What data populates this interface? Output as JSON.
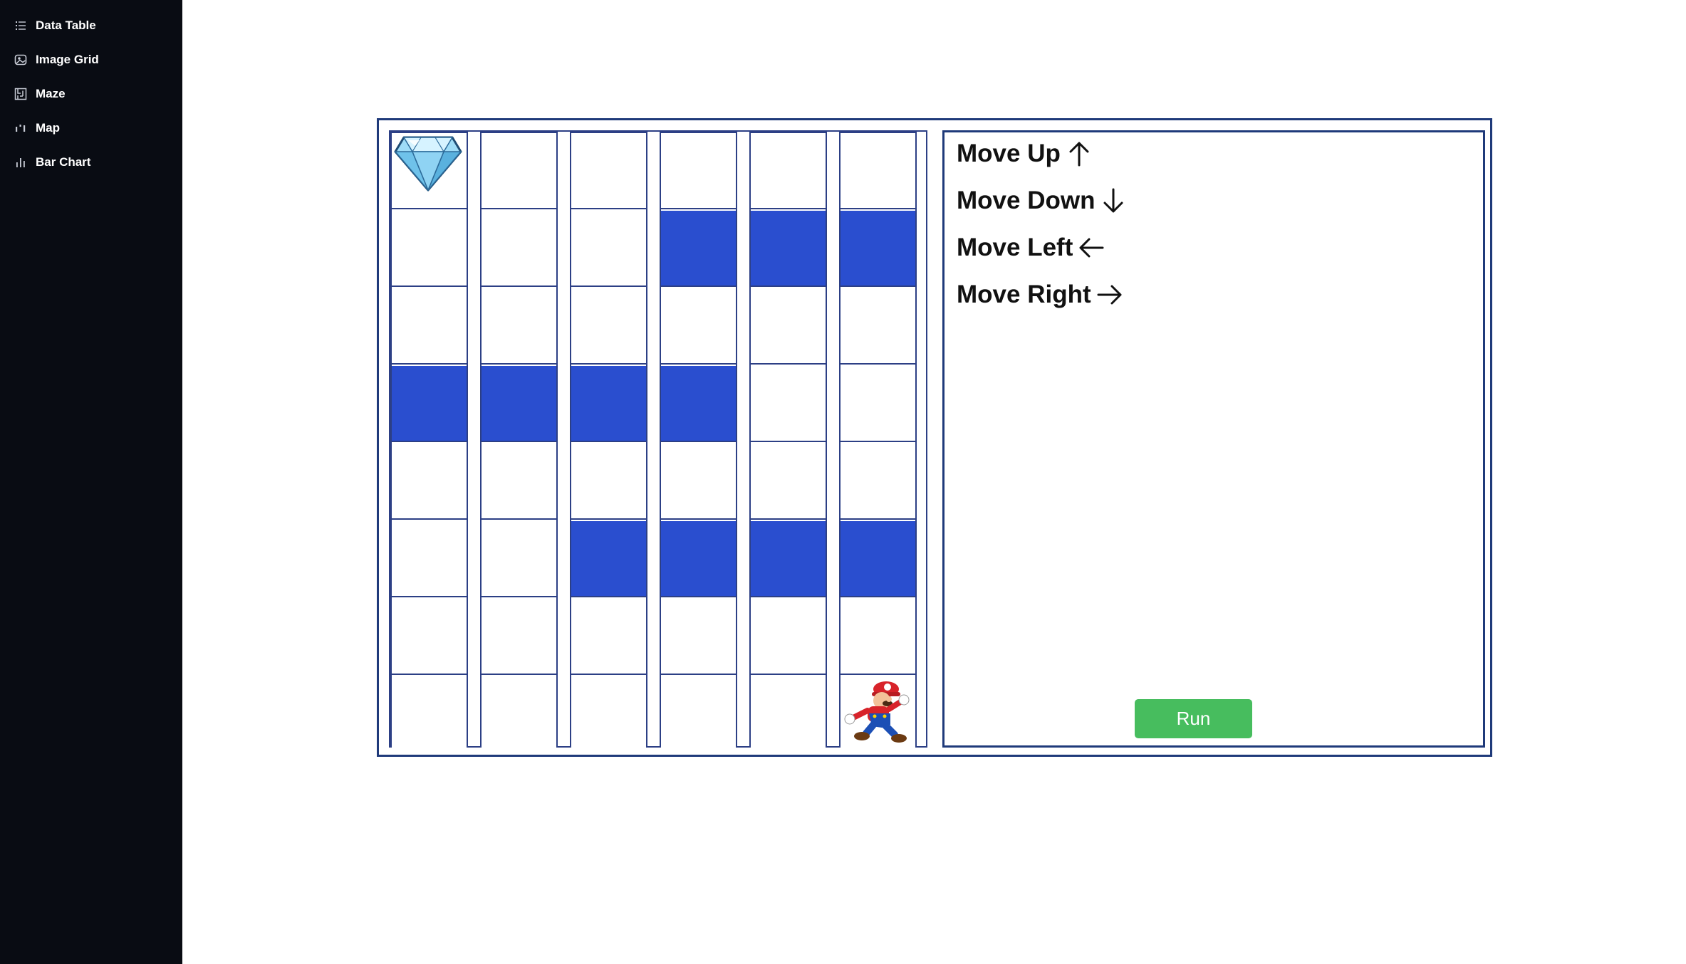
{
  "sidebar": {
    "items": [
      {
        "label": "Data Table",
        "icon": "list-icon"
      },
      {
        "label": "Image Grid",
        "icon": "image-grid-icon"
      },
      {
        "label": "Maze",
        "icon": "maze-icon"
      },
      {
        "label": "Map",
        "icon": "map-icon"
      },
      {
        "label": "Bar Chart",
        "icon": "bar-chart-icon"
      }
    ]
  },
  "maze": {
    "rows": 8,
    "cols": 6,
    "walls": [
      [
        1,
        3
      ],
      [
        1,
        4
      ],
      [
        1,
        5
      ],
      [
        3,
        0
      ],
      [
        3,
        1
      ],
      [
        3,
        2
      ],
      [
        3,
        3
      ],
      [
        5,
        2
      ],
      [
        5,
        3
      ],
      [
        5,
        4
      ],
      [
        5,
        5
      ]
    ],
    "goal": {
      "row": 0,
      "col": 0,
      "icon": "diamond-icon"
    },
    "player": {
      "row": 7,
      "col": 5,
      "icon": "mario-character-icon"
    }
  },
  "commands": [
    {
      "label": "Move Up",
      "arrow": "arrow-up-icon"
    },
    {
      "label": "Move Down",
      "arrow": "arrow-down-icon"
    },
    {
      "label": "Move Left",
      "arrow": "arrow-left-icon"
    },
    {
      "label": "Move Right",
      "arrow": "arrow-right-icon"
    }
  ],
  "run_button": {
    "label": "Run"
  },
  "colors": {
    "sidebar_bg": "#090c13",
    "wall": "#2a4ecf",
    "border": "#1f3a7a",
    "run_button": "#47bd5e"
  }
}
